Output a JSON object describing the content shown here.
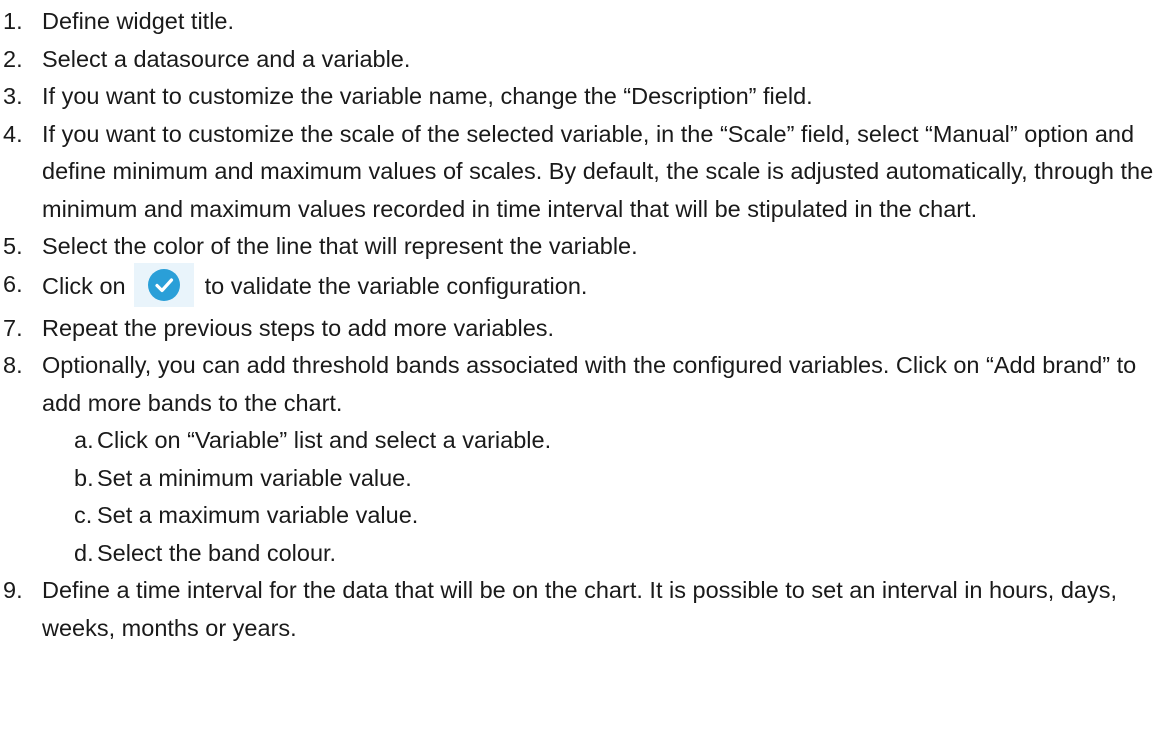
{
  "steps": [
    {
      "num": "1.",
      "text": "Define widget title."
    },
    {
      "num": "2.",
      "text": "Select a datasource and a variable."
    },
    {
      "num": "3.",
      "text": "If you want to customize the variable name, change the “Description” field."
    },
    {
      "num": "4.",
      "text": "If you want to customize the scale of the selected variable, in the “Scale” field, select “Manual” option and define minimum and maximum values of scales. By default, the scale is adjusted automatically, through the minimum and maximum values recorded in time interval that will be stipulated in the chart."
    },
    {
      "num": "5.",
      "text": "Select the color of the line that will represent the variable."
    },
    {
      "num": "6.",
      "text_before": "Click on",
      "icon": "check-circle-icon",
      "icon_color": "#2a9fd8",
      "text_after": "to validate the variable configuration."
    },
    {
      "num": "7.",
      "text": "Repeat the previous steps to add more variables."
    },
    {
      "num": "8.",
      "text": "Optionally, you can add threshold bands associated with the configured variables. Click on “Add brand” to add more bands to the chart.",
      "substeps": [
        {
          "num": "a.",
          "text": "Click on “Variable” list and select a variable."
        },
        {
          "num": "b.",
          "text": "Set a minimum variable value."
        },
        {
          "num": "c.",
          "text": "Set a maximum variable value."
        },
        {
          "num": "d.",
          "text": "Select the band colour."
        }
      ]
    },
    {
      "num": "9.",
      "text": "Define a time interval for the data that will be on the chart. It is possible to set an interval in hours, days, weeks, months or years."
    }
  ]
}
